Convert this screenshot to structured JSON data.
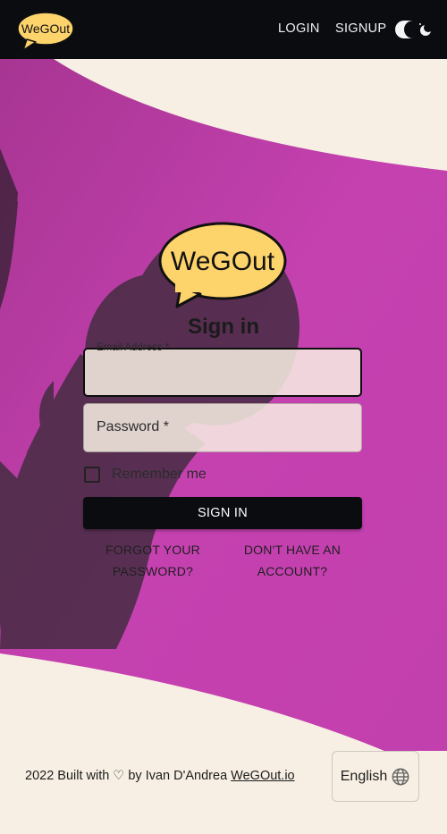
{
  "navbar": {
    "logo_text": "WeGOut",
    "login_label": "LOGIN",
    "signup_label": "SIGNUP",
    "theme_toggle_icon": "moon-icon"
  },
  "hero": {
    "logo_text": "WeGOut",
    "title": "Sign in",
    "email_label": "Email Address *",
    "email_value": "",
    "password_label": "Password *",
    "password_value": "",
    "remember_label": "Remember me",
    "remember_checked": false,
    "signin_label": "SIGN IN",
    "forgot_label": "FORGOT YOUR PASSWORD?",
    "no_account_label": "DON'T HAVE AN ACCOUNT?"
  },
  "footer": {
    "credit_text": "2022 Built with ♡ by Ivan D'Andrea",
    "link_text": "WeGOut.io",
    "language_label": "English",
    "language_icon": "globe-icon"
  },
  "colors": {
    "navbar_bg": "#0b0c10",
    "hero_pink": "#c541b0",
    "cream": "#f7efe3",
    "logo_yellow": "#fdd36b"
  }
}
